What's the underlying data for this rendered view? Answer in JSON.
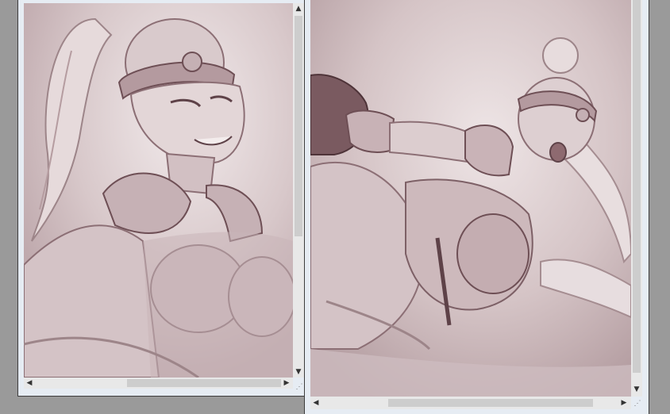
{
  "left_window": {
    "vscroll_up": "▲",
    "vscroll_down": "▼",
    "hscroll_left": "◀",
    "hscroll_right": "▶",
    "grip": "⋰"
  },
  "right_window": {
    "vscroll_up": "▲",
    "vscroll_down": "▼",
    "hscroll_left": "◀",
    "hscroll_right": "▶",
    "grip": "⋰"
  },
  "colors": {
    "sepia_light": "#e9dfe0",
    "sepia_mid": "#b79ea2",
    "sepia_dark": "#6e4f55",
    "window_frame": "#e6ecf3",
    "scrollbar_track": "#e8e8e8",
    "scrollbar_thumb": "#cdcdcd"
  }
}
